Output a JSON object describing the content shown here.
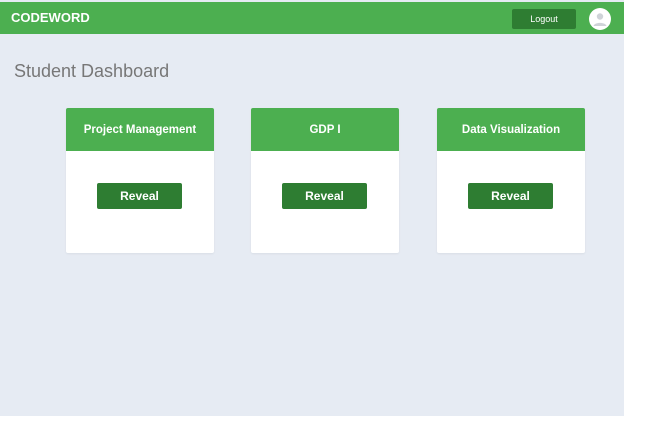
{
  "header": {
    "brand": "CODEWORD",
    "logout_label": "Logout",
    "avatar_icon": "user-avatar-icon"
  },
  "main": {
    "title": "Student Dashboard",
    "cards": [
      {
        "title": "Project Management",
        "button_label": "Reveal"
      },
      {
        "title": "GDP I",
        "button_label": "Reveal"
      },
      {
        "title": "Data Visualization",
        "button_label": "Reveal"
      }
    ]
  },
  "colors": {
    "primary": "#4caf50",
    "primary_dark": "#2e7d32",
    "background": "#e6ebf3"
  }
}
